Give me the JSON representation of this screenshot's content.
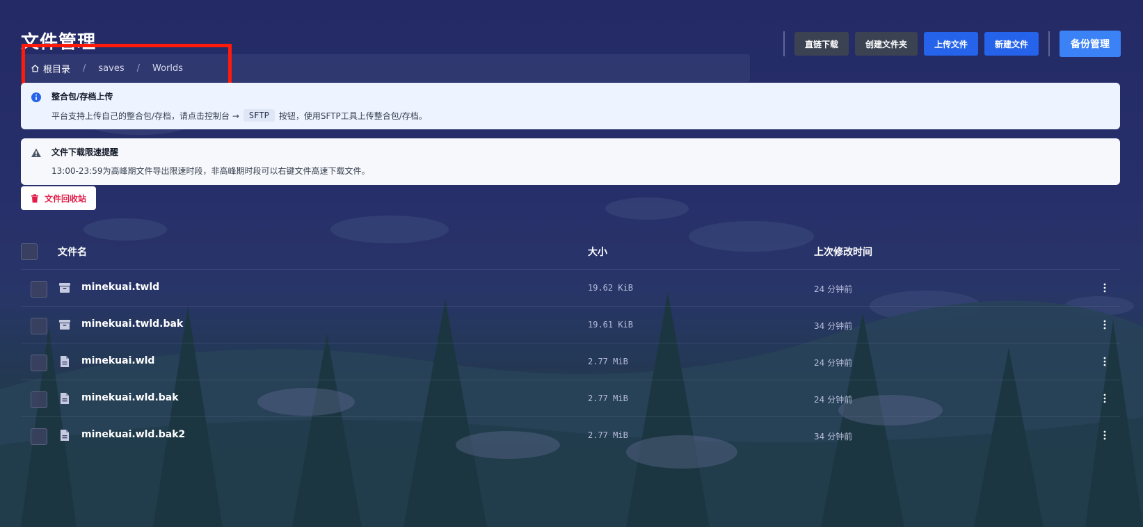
{
  "page_title": "文件管理",
  "breadcrumb": {
    "home_label": "根目录",
    "separator": "/",
    "segments": [
      "saves",
      "Worlds"
    ]
  },
  "toolbar": {
    "direct_download": "直链下载",
    "create_folder": "创建文件夹",
    "upload_file": "上传文件",
    "new_file": "新建文件",
    "backup_manage": "备份管理"
  },
  "alerts": {
    "upload": {
      "title": "整合包/存档上传",
      "text_before": "平台支持上传自己的整合包/存档，请点击控制台 →",
      "badge": "SFTP",
      "text_after": "按钮，使用SFTP工具上传整合包/存档。"
    },
    "download": {
      "title": "文件下载限速提醒",
      "text": "13:00-23:59为高峰期文件导出限速时段，非高峰期时段可以右键文件高速下载文件。"
    }
  },
  "recycle_bin": "文件回收站",
  "table": {
    "headers": {
      "name": "文件名",
      "size": "大小",
      "modified": "上次修改时间"
    },
    "rows": [
      {
        "name": "minekuai.twld",
        "size": "19.62 KiB",
        "modified": "24 分钟前",
        "icon": "archive-icon"
      },
      {
        "name": "minekuai.twld.bak",
        "size": "19.61 KiB",
        "modified": "34 分钟前",
        "icon": "archive-icon"
      },
      {
        "name": "minekuai.wld",
        "size": "2.77 MiB",
        "modified": "24 分钟前",
        "icon": "file-icon"
      },
      {
        "name": "minekuai.wld.bak",
        "size": "2.77 MiB",
        "modified": "24 分钟前",
        "icon": "file-icon"
      },
      {
        "name": "minekuai.wld.bak2",
        "size": "2.77 MiB",
        "modified": "34 分钟前",
        "icon": "file-icon"
      }
    ]
  },
  "colors": {
    "accent_blue": "#2563eb",
    "backup_blue": "#3b82f6",
    "danger": "#e11d48",
    "highlight": "#ff1a0a"
  }
}
